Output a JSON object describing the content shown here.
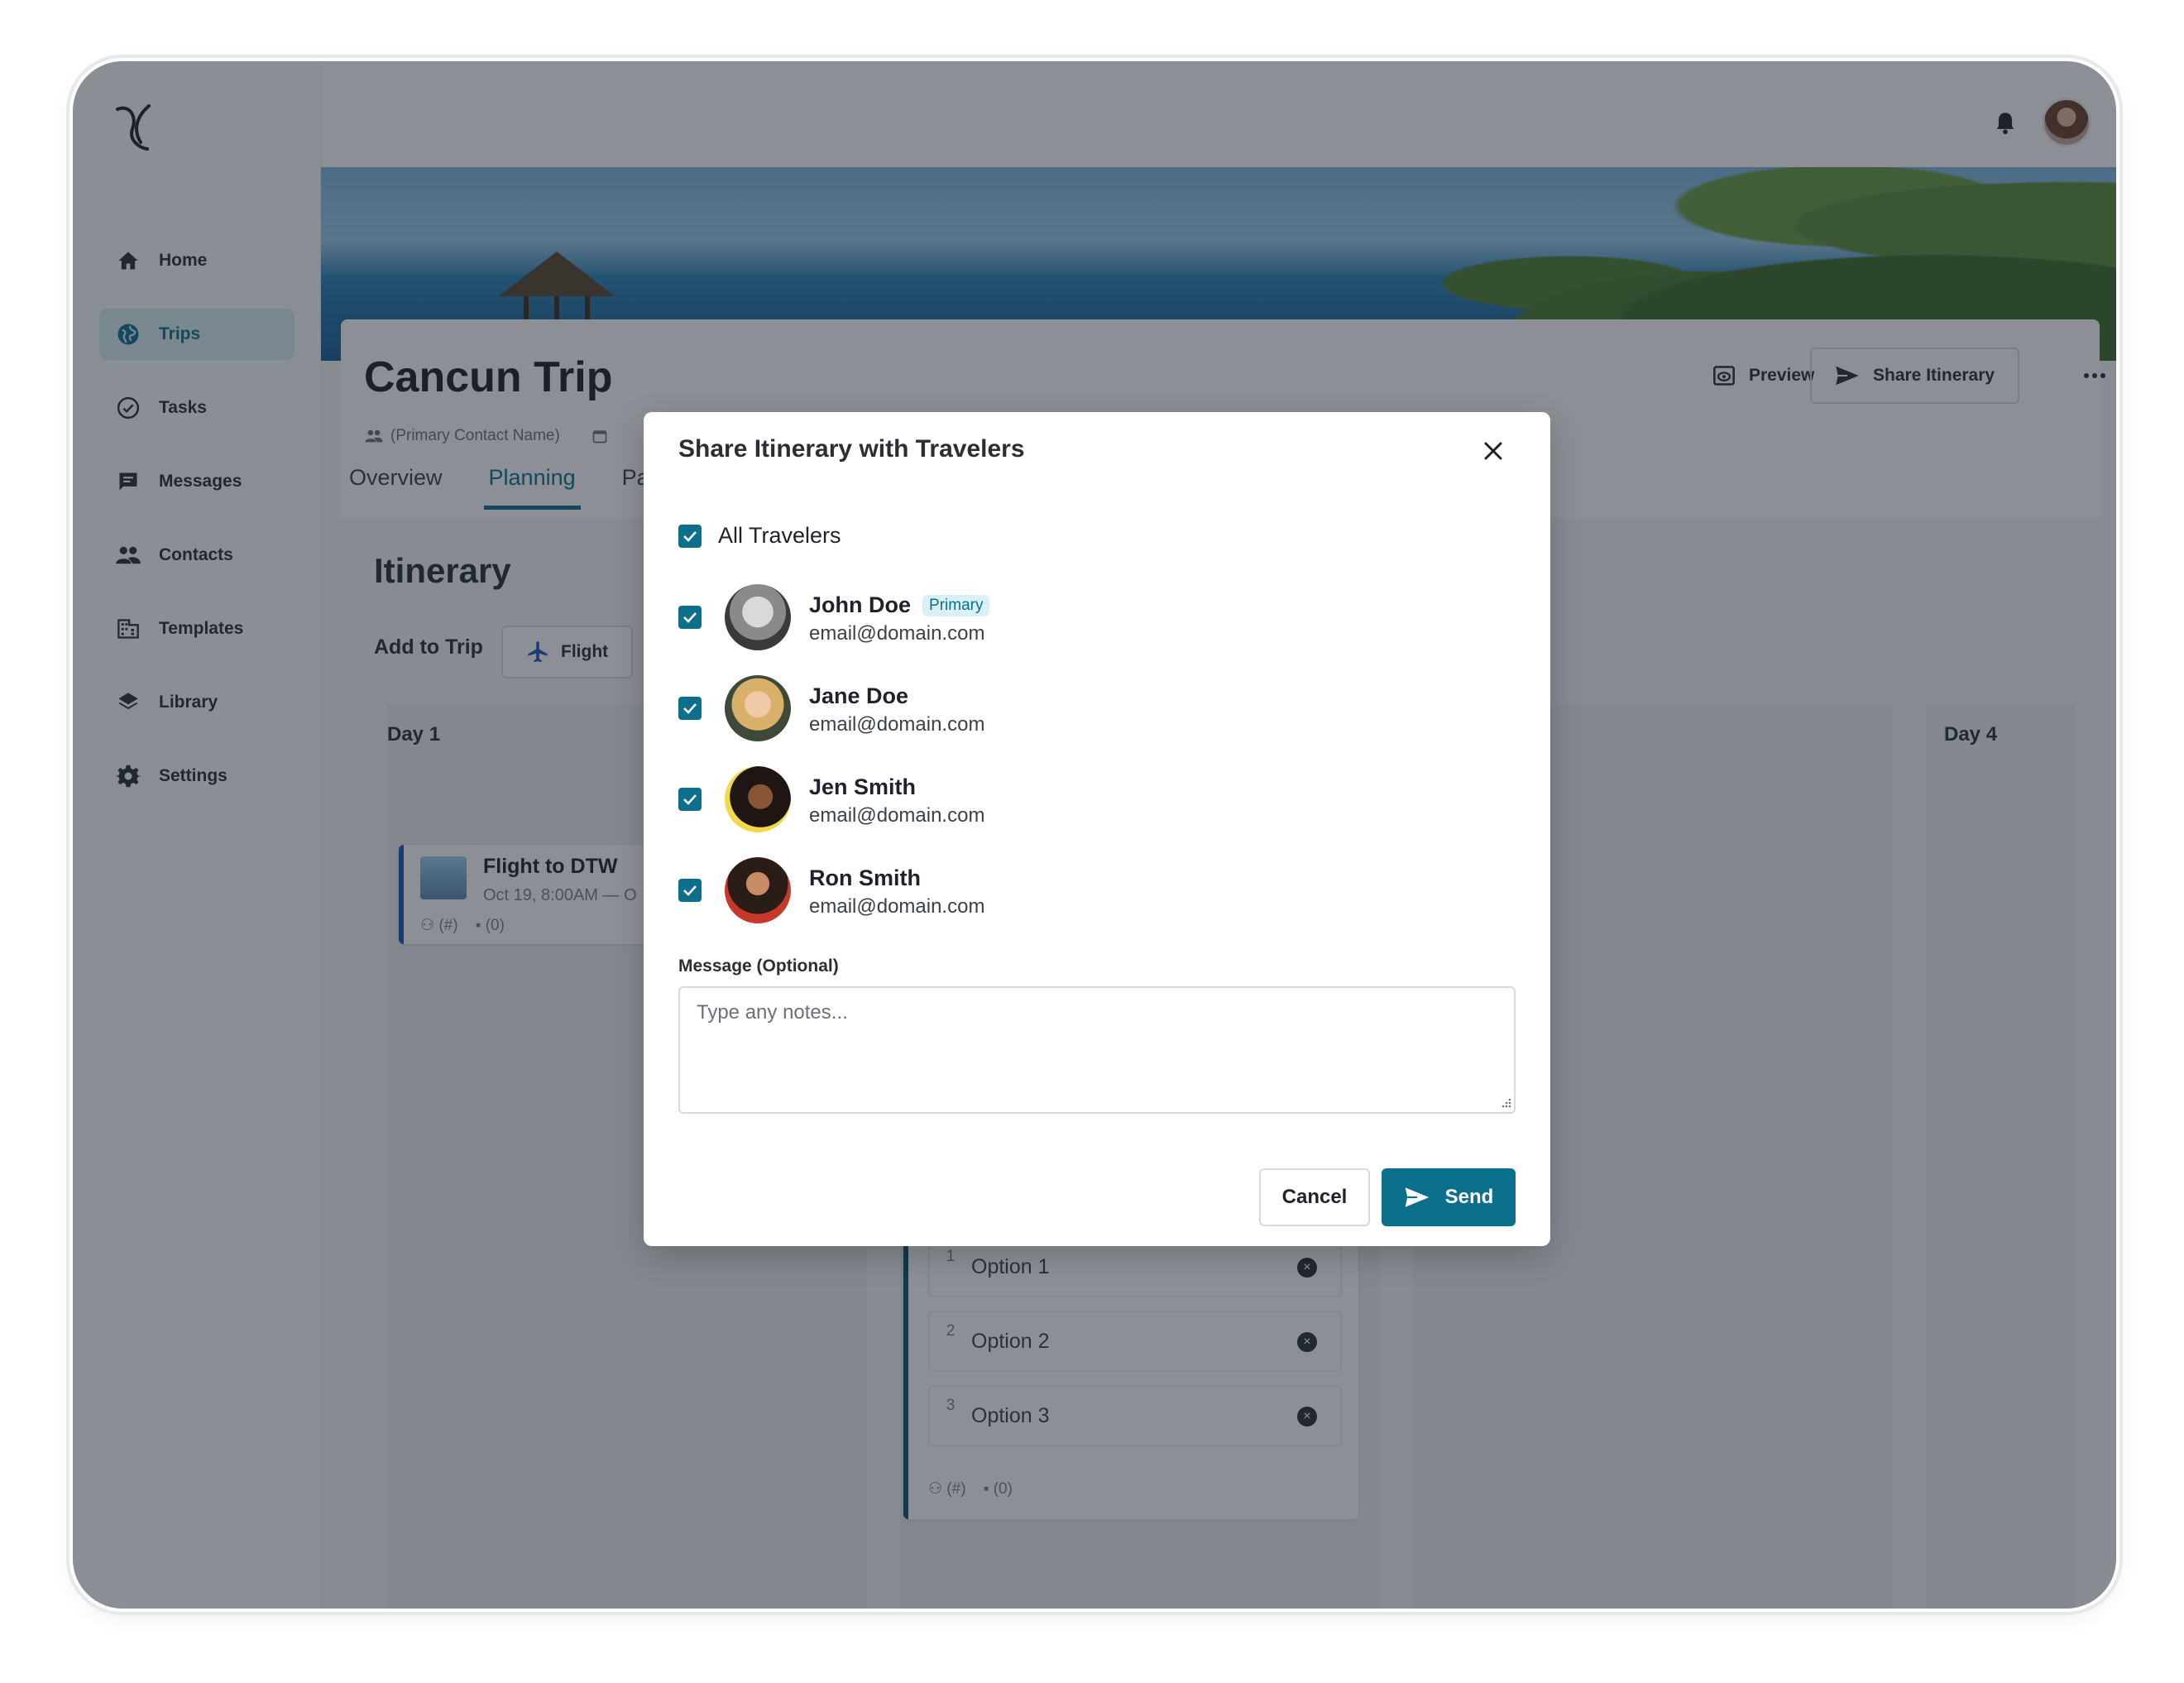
{
  "sidebar": {
    "items": [
      {
        "label": "Home",
        "icon": "home-icon"
      },
      {
        "label": "Trips",
        "icon": "globe-icon",
        "active": true
      },
      {
        "label": "Tasks",
        "icon": "check-circle-icon"
      },
      {
        "label": "Messages",
        "icon": "message-icon"
      },
      {
        "label": "Contacts",
        "icon": "people-icon"
      },
      {
        "label": "Templates",
        "icon": "building-icon"
      },
      {
        "label": "Library",
        "icon": "layers-icon"
      },
      {
        "label": "Settings",
        "icon": "gear-icon"
      }
    ]
  },
  "trip": {
    "title": "Cancun Trip",
    "contact": "(Primary Contact Name)",
    "preview_label": "Preview",
    "share_label": "Share Itinerary",
    "tabs": [
      "Overview",
      "Planning",
      "Pay"
    ]
  },
  "itinerary": {
    "title": "Itinerary",
    "add_label": "Add to Trip",
    "flight_btn": "Flight",
    "days": [
      "Day 1",
      "Day 4"
    ],
    "flight_card": {
      "name": "Flight to DTW",
      "date": "Oct 19, 8:00AM — O",
      "travelers": "(#)",
      "comments": "(0)"
    },
    "options": [
      "Option 1",
      "Option 2",
      "Option 3"
    ],
    "option_nums": [
      "1",
      "2",
      "3"
    ],
    "options_footer": {
      "travelers": "(#)",
      "comments": "(0)"
    }
  },
  "modal": {
    "title": "Share Itinerary with Travelers",
    "all_label": "All Travelers",
    "travelers": [
      {
        "name": "John Doe",
        "email": "email@domain.com",
        "badge": "Primary",
        "checked": true
      },
      {
        "name": "Jane Doe",
        "email": "email@domain.com",
        "checked": true
      },
      {
        "name": "Jen Smith",
        "email": "email@domain.com",
        "checked": true
      },
      {
        "name": "Ron Smith",
        "email": "email@domain.com",
        "checked": true
      }
    ],
    "message_label": "Message (Optional)",
    "message_placeholder": "Type any notes...",
    "message_value": "",
    "cancel_label": "Cancel",
    "send_label": "Send"
  },
  "colors": {
    "accent": "#0c6f8c",
    "active_bg": "#d9eef1",
    "badge_bg": "#d9f1f6",
    "flight_bar": "#1d55b6"
  }
}
